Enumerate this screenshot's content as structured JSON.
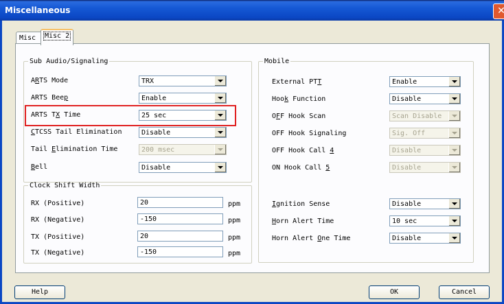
{
  "window": {
    "title": "Miscellaneous",
    "close_glyph": "✕"
  },
  "tabs": {
    "misc1": "Misc 1",
    "misc2": "Misc 2"
  },
  "sub_audio": {
    "legend": "Sub Audio/Signaling",
    "arts_mode": {
      "label_pre": "A",
      "label_u": "R",
      "label_post": "TS Mode",
      "value": "TRX"
    },
    "arts_beep": {
      "label_pre": "ARTS Bee",
      "label_u": "p",
      "label_post": "",
      "value": "Enable"
    },
    "arts_tx_time": {
      "label_pre": "ARTS T",
      "label_u": "X",
      "label_post": " Time",
      "value": "25 sec"
    },
    "ctcss_tail": {
      "label_pre": "",
      "label_u": "C",
      "label_post": "TCSS Tail Elimination",
      "value": "Disable"
    },
    "tail_elim_time": {
      "label_pre": "Tail ",
      "label_u": "E",
      "label_post": "limination Time",
      "value": "200 msec"
    },
    "bell": {
      "label_pre": "",
      "label_u": "B",
      "label_post": "ell",
      "value": "Disable"
    }
  },
  "clock_shift": {
    "legend": "Clock Shift Width",
    "unit": "ppm",
    "rx_pos": {
      "label": "RX (Positive)",
      "value": "20"
    },
    "rx_neg": {
      "label": "RX (Negative)",
      "value": "-150"
    },
    "tx_pos": {
      "label": "TX (Positive)",
      "value": "20"
    },
    "tx_neg": {
      "label": "TX (Negative)",
      "value": "-150"
    }
  },
  "mobile": {
    "legend": "Mobile",
    "external_ptt": {
      "label_pre": "External PT",
      "label_u": "T",
      "label_post": "",
      "value": "Enable"
    },
    "hook_function": {
      "label_pre": "Hoo",
      "label_u": "k",
      "label_post": " Function",
      "value": "Disable"
    },
    "off_hook_scan": {
      "label_pre": "O",
      "label_u": "F",
      "label_post": "F Hook Scan",
      "value": "Scan Disable"
    },
    "off_hook_signaling": {
      "label": "OFF Hook Signaling",
      "value": "Sig. Off"
    },
    "off_hook_call": {
      "label_pre": "OFF Hook Call ",
      "label_u": "4",
      "label_post": "",
      "value": "Disable"
    },
    "on_hook_call": {
      "label_pre": "ON Hook Call ",
      "label_u": "5",
      "label_post": "",
      "value": "Disable"
    },
    "ignition_sense": {
      "label_pre": "",
      "label_u": "I",
      "label_post": "gnition Sense",
      "value": "Disable"
    },
    "horn_alert_time": {
      "label_pre": "",
      "label_u": "H",
      "label_post": "orn Alert Time",
      "value": "10 sec"
    },
    "horn_alert_one": {
      "label_pre": "Horn Alert ",
      "label_u": "O",
      "label_post": "ne Time",
      "value": "Disable"
    }
  },
  "buttons": {
    "help": "Help",
    "ok": "OK",
    "cancel": "Cancel"
  }
}
